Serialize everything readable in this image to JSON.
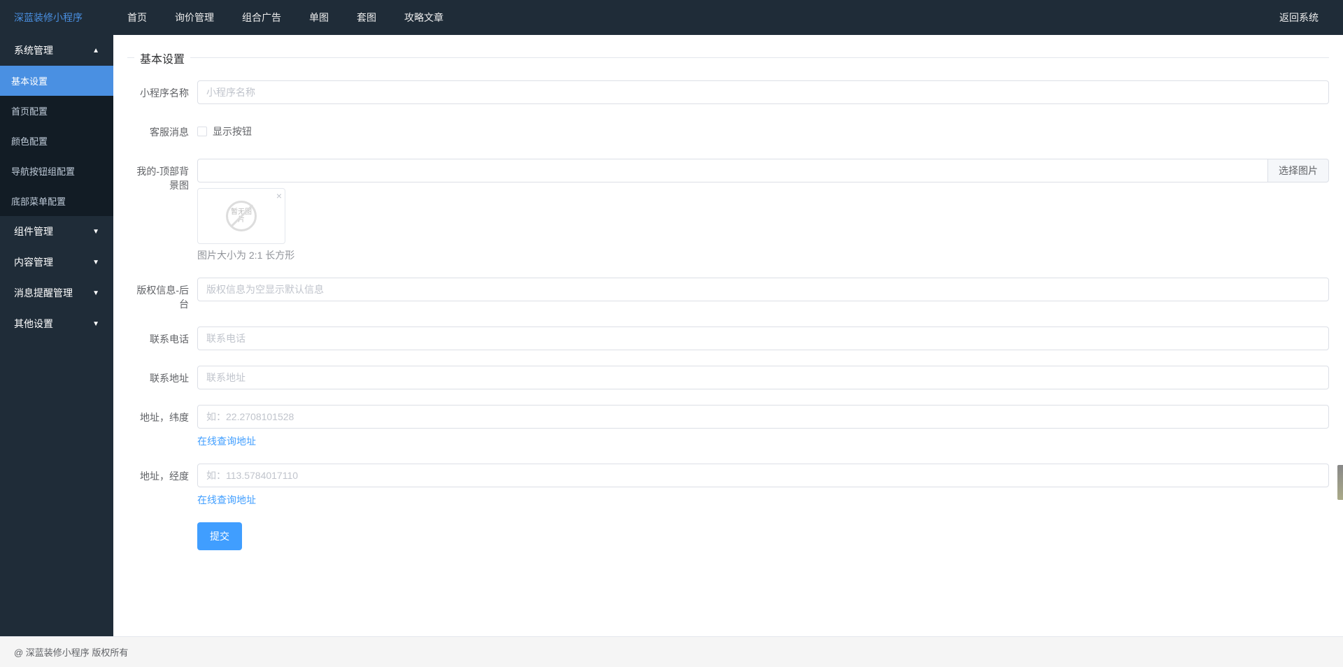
{
  "brand": "深蓝装修小程序",
  "topnav": [
    "首页",
    "询价管理",
    "组合广告",
    "单图",
    "套图",
    "攻略文章"
  ],
  "return_system": "返回系统",
  "sidebar": {
    "groups": [
      {
        "label": "系统管理",
        "expanded": true,
        "items": [
          "基本设置",
          "首页配置",
          "颜色配置",
          "导航按钮组配置",
          "底部菜单配置"
        ],
        "active_index": 0
      },
      {
        "label": "组件管理",
        "expanded": false,
        "items": []
      },
      {
        "label": "内容管理",
        "expanded": false,
        "items": []
      },
      {
        "label": "消息提醒管理",
        "expanded": false,
        "items": []
      },
      {
        "label": "其他设置",
        "expanded": false,
        "items": []
      }
    ]
  },
  "page_title": "基本设置",
  "form": {
    "app_name": {
      "label": "小程序名称",
      "placeholder": "小程序名称",
      "value": ""
    },
    "customer_msg": {
      "label": "客服消息",
      "checkbox_label": "显示按钮",
      "checked": false
    },
    "top_bg": {
      "label": "我的-顶部背景图",
      "select_btn": "选择图片",
      "no_image_text": "暂无图片",
      "hint": "图片大小为 2:1 长方形"
    },
    "copyright": {
      "label": "版权信息-后台",
      "placeholder": "版权信息为空显示默认信息",
      "value": ""
    },
    "phone": {
      "label": "联系电话",
      "placeholder": "联系电话",
      "value": ""
    },
    "address": {
      "label": "联系地址",
      "placeholder": "联系地址",
      "value": ""
    },
    "latitude": {
      "label": "地址，纬度",
      "placeholder": "如：22.2708101528",
      "value": "",
      "link": "在线查询地址"
    },
    "longitude": {
      "label": "地址，经度",
      "placeholder": "如：113.5784017110",
      "value": "",
      "link": "在线查询地址"
    },
    "submit": "提交"
  },
  "footer": "@ 深蓝装修小程序 版权所有"
}
